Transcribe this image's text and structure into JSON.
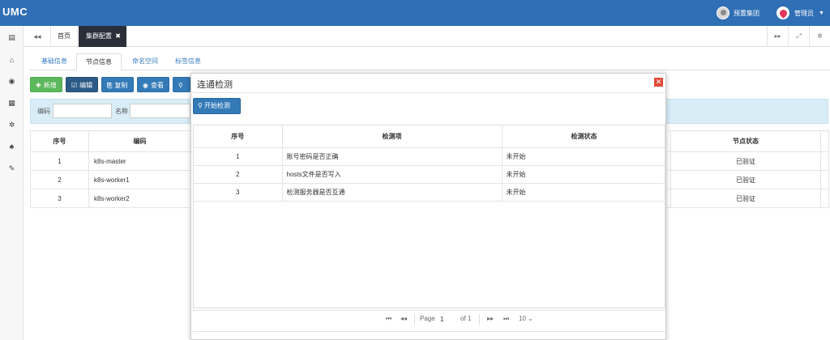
{
  "header": {
    "logo": "UMC",
    "cluster_label": "预置集团",
    "user_label": "管理员"
  },
  "tabs": {
    "home": "首页",
    "active": "集群配置"
  },
  "subtabs": [
    "基础信息",
    "节点信息",
    "命名空间",
    "标签信息"
  ],
  "toolbar": {
    "add": "新增",
    "edit": "编辑",
    "copy": "复制",
    "view": "查看"
  },
  "filter": {
    "code_label": "编码",
    "name_label": "名称"
  },
  "nodes_table": {
    "headers": {
      "seq": "序号",
      "code": "编码",
      "status": "节点状态"
    },
    "rows": [
      {
        "seq": "1",
        "code": "k8s-master",
        "status": "已验证"
      },
      {
        "seq": "2",
        "code": "k8s-worker1",
        "status": "已验证"
      },
      {
        "seq": "3",
        "code": "k8s-worker2",
        "status": "已验证"
      }
    ]
  },
  "modal": {
    "title": "连通检测",
    "start_button": "开始检测",
    "headers": {
      "seq": "序号",
      "item": "检测项",
      "status": "检测状态"
    },
    "rows": [
      {
        "seq": "1",
        "item": "账号密码是否正确",
        "status": "未开始"
      },
      {
        "seq": "2",
        "item": "hosts文件是否写入",
        "status": "未开始"
      },
      {
        "seq": "3",
        "item": "检测服务器是否互通",
        "status": "未开始"
      }
    ],
    "pager": {
      "page_label": "Page",
      "page_value": "1",
      "of_label": "of 1",
      "page_size": "10"
    }
  },
  "colors": {
    "header": "#2f6fb5",
    "btn_add": "#5cb85c",
    "btn_dark": "#2c5a86",
    "btn_blue": "#337ab7",
    "close": "#e04a3a",
    "filter_bg": "#d9edf7"
  }
}
